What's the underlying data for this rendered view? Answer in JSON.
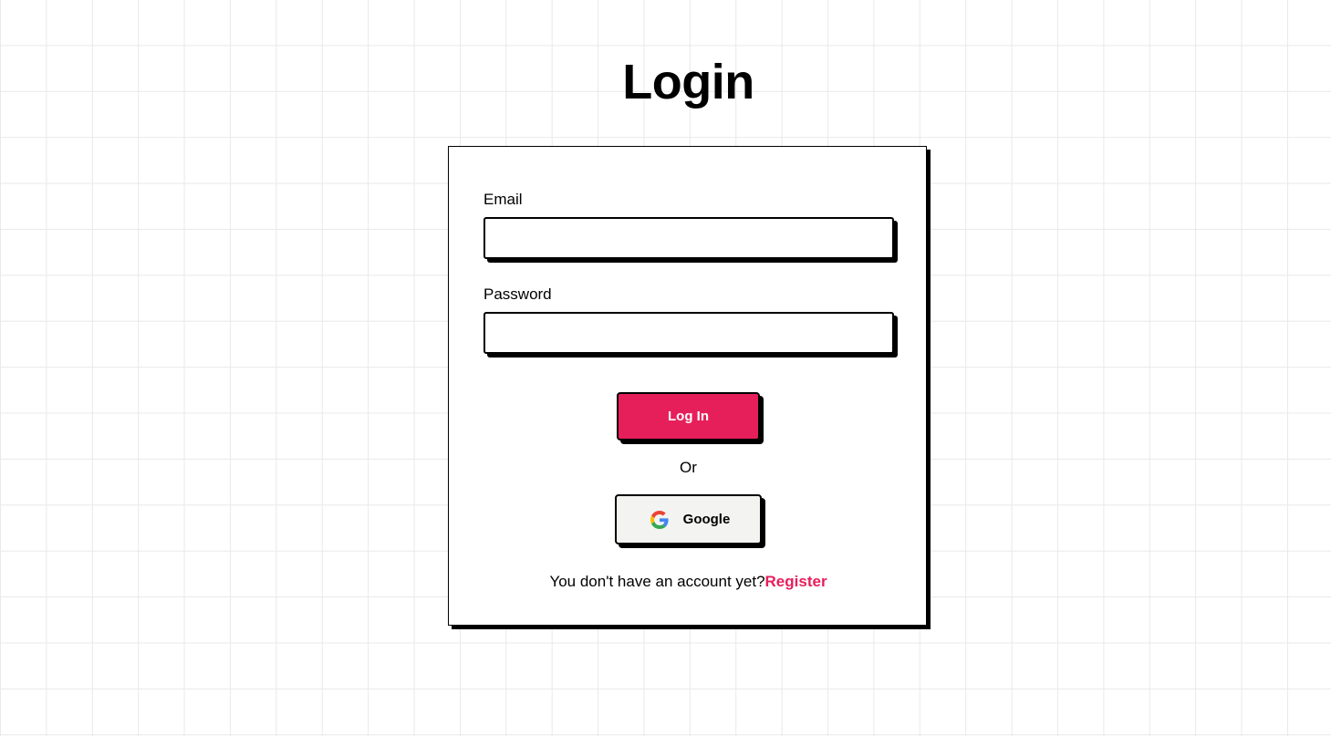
{
  "page": {
    "title": "Login"
  },
  "form": {
    "email_label": "Email",
    "email_value": "",
    "password_label": "Password",
    "password_value": "",
    "login_button_label": "Log In",
    "or_text": "Or",
    "google_button_label": "Google",
    "no_account_text": "You don't have an account yet?",
    "register_link_label": "Register"
  },
  "icons": {
    "google": "google-icon"
  },
  "colors": {
    "accent": "#e61f5b",
    "google_button_bg": "#f3f3f1",
    "border": "#000000",
    "grid_line": "#e9e9ec"
  }
}
